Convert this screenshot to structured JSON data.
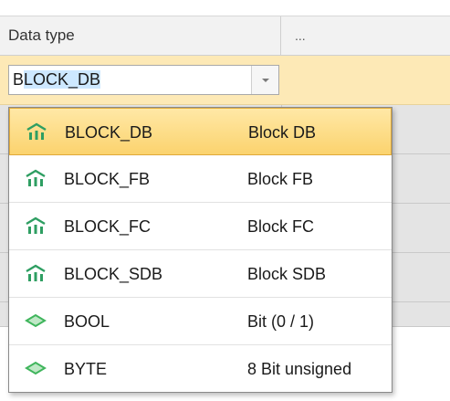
{
  "grid": {
    "columns": [
      {
        "header": "Data type"
      },
      {
        "header": "..."
      }
    ]
  },
  "editor": {
    "first_char": "B",
    "selected_text": "LOCK_DB",
    "dropdown_arrow_icon": "chevron-down-icon"
  },
  "dropdown": {
    "items": [
      {
        "name": "BLOCK_DB",
        "description": "Block DB",
        "icon": "block-icon",
        "selected": true
      },
      {
        "name": "BLOCK_FB",
        "description": "Block FB",
        "icon": "block-icon",
        "selected": false
      },
      {
        "name": "BLOCK_FC",
        "description": "Block FC",
        "icon": "block-icon",
        "selected": false
      },
      {
        "name": "BLOCK_SDB",
        "description": "Block SDB",
        "icon": "block-icon",
        "selected": false
      },
      {
        "name": "BOOL",
        "description": "Bit (0 / 1)",
        "icon": "elementary-type-icon",
        "selected": false
      },
      {
        "name": "BYTE",
        "description": "8 Bit unsigned",
        "icon": "elementary-type-icon",
        "selected": false
      }
    ]
  },
  "colors": {
    "edit_row": "#fde9b6",
    "selection_highlight": "#fbd36e",
    "block_icon": "#2e9e62",
    "elementary_icon": "#3fb55c"
  }
}
